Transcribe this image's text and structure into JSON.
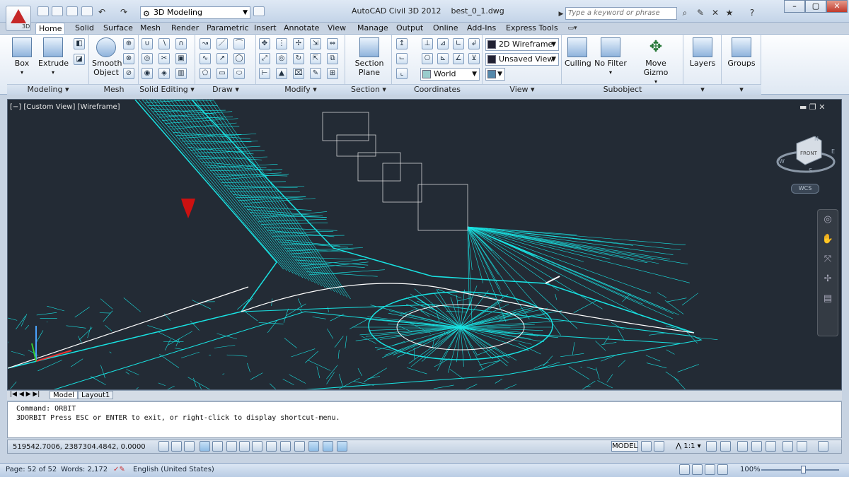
{
  "titlebar": {
    "workspace": "3D Modeling",
    "app_title": "AutoCAD Civil 3D 2012",
    "file": "best_0_1.dwg",
    "search_placeholder": "Type a keyword or phrase",
    "app_version": "3D"
  },
  "tabs": [
    "Home",
    "Solid",
    "Surface",
    "Mesh",
    "Render",
    "Parametric",
    "Insert",
    "Annotate",
    "View",
    "Manage",
    "Output",
    "Online",
    "Add-Ins",
    "Express Tools"
  ],
  "panels": {
    "modeling": "Modeling",
    "mesh": "Mesh",
    "solid_editing": "Solid Editing",
    "draw": "Draw",
    "modify": "Modify",
    "section": "Section",
    "coordinates": "Coordinates",
    "view": "View",
    "subobject": "Subobject"
  },
  "buttons": {
    "box": "Box",
    "extrude": "Extrude",
    "smooth1": "Smooth",
    "smooth2": "Object",
    "section1": "Section",
    "section2": "Plane",
    "culling": "Culling",
    "nofilter": "No Filter",
    "movegizmo": "Move Gizmo",
    "layers": "Layers",
    "groups": "Groups"
  },
  "combos": {
    "visual_style": "2D Wireframe",
    "saved_view": "Unsaved View",
    "ucs": "World"
  },
  "viewport": {
    "label": "[−] [Custom View] [Wireframe]",
    "viewcube_face": "FRONT",
    "wcs": "WCS",
    "compass_n": "N",
    "compass_s": "S",
    "compass_w": "W",
    "compass_e": "E",
    "wire_color": "#19e3e3"
  },
  "layout_tabs": [
    "Model",
    "Layout1"
  ],
  "command": {
    "line1": "Command: ORBIT",
    "line2": "3DORBIT Press ESC or ENTER to exit, or right-click to display shortcut-menu."
  },
  "status": {
    "coords": "519542.7006, 2387304.4842, 0.0000",
    "model": "MODEL",
    "scale": "1:1"
  },
  "word": {
    "page": "Page: 52 of 52",
    "words": "Words: 2,172",
    "lang": "English (United States)",
    "zoom": "100%"
  }
}
